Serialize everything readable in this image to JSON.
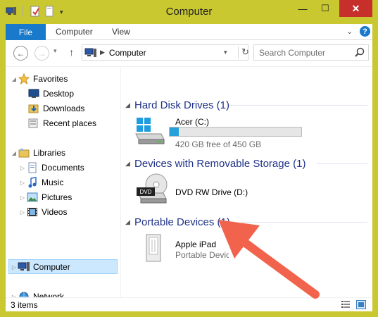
{
  "window": {
    "title": "Computer",
    "controls": {
      "minimize": "—",
      "maximize": "☐",
      "close": "✕"
    },
    "frame_color": "#c9c830",
    "accent": "#1979ca"
  },
  "ribbon": {
    "file_tab": "File",
    "tabs": [
      "Computer",
      "View"
    ],
    "expand_icon": "chevron-down-icon",
    "help_label": "?"
  },
  "address": {
    "location": "Computer",
    "search_placeholder": "Search Computer"
  },
  "nav": {
    "favorites": "Favorites",
    "favorite_items": [
      "Desktop",
      "Downloads",
      "Recent places"
    ],
    "libraries": "Libraries",
    "library_items": [
      "Documents",
      "Music",
      "Pictures",
      "Videos"
    ],
    "computer": "Computer",
    "network": "Network"
  },
  "groups": {
    "hard_disk": {
      "title": "Hard Disk Drives (1)",
      "items": [
        {
          "name": "Acer (C:)",
          "detail": "420 GB free of 450 GB",
          "used_fraction": 0.067
        }
      ]
    },
    "removable": {
      "title": "Devices with Removable Storage (1)",
      "items": [
        {
          "name": "DVD RW Drive (D:)",
          "badge": "DVD"
        }
      ]
    },
    "portable": {
      "title": "Portable Devices (1)",
      "items": [
        {
          "name": "Apple iPad",
          "detail": "Portable Device"
        }
      ]
    }
  },
  "status": {
    "count": "3 items"
  },
  "annotation": {
    "arrow_color": "#f1634c",
    "target": "Apple iPad"
  }
}
